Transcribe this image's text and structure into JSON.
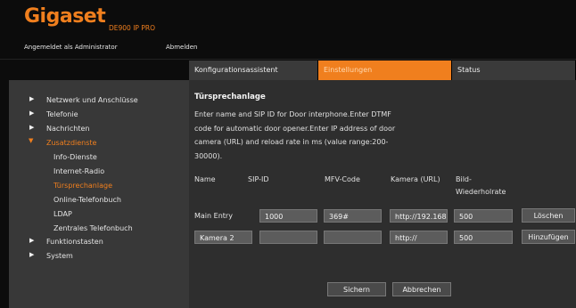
{
  "header": {
    "brand": "Gigaset",
    "model": "DE900 IP PRO",
    "logged_in_as": "Angemeldet als Administrator",
    "logout": "Abmelden"
  },
  "tabs": [
    {
      "label": "Konfigurationsassistent",
      "active": false
    },
    {
      "label": "Einstellungen",
      "active": true
    },
    {
      "label": "Status",
      "active": false
    }
  ],
  "sidebar": {
    "items": [
      {
        "label": "Netzwerk und Anschlüsse",
        "level": 0,
        "expanded": false,
        "active": false
      },
      {
        "label": "Telefonie",
        "level": 0,
        "expanded": false,
        "active": false
      },
      {
        "label": "Nachrichten",
        "level": 0,
        "expanded": false,
        "active": false
      },
      {
        "label": "Zusatzdienste",
        "level": 0,
        "expanded": true,
        "active": true
      },
      {
        "label": "Info-Dienste",
        "level": 1,
        "active": false
      },
      {
        "label": "Internet-Radio",
        "level": 1,
        "active": false
      },
      {
        "label": "Türsprechanlage",
        "level": 1,
        "active": true
      },
      {
        "label": "Online-Telefonbuch",
        "level": 1,
        "active": false
      },
      {
        "label": "LDAP",
        "level": 1,
        "active": false
      },
      {
        "label": "Zentrales Telefonbuch",
        "level": 1,
        "active": false
      },
      {
        "label": "Funktionstasten",
        "level": 0,
        "expanded": false,
        "active": false
      },
      {
        "label": "System",
        "level": 0,
        "expanded": false,
        "active": false
      }
    ]
  },
  "main": {
    "title": "Türsprechanlage",
    "description": "Enter name and SIP ID for Door interphone.Enter DTMF code for automatic door opener.Enter IP address of door camera (URL) and reload rate in ms (value range:200-30000).",
    "columns": [
      "Name",
      "SIP-ID",
      "MFV-Code",
      "Kamera (URL)",
      "Bild-Wiederholrate"
    ],
    "entries": [
      {
        "name": "Main Entry",
        "sip_id": "1000",
        "mfv_code": "369#",
        "camera_url": "http://192.168.",
        "rate": "500",
        "action": "Löschen"
      }
    ],
    "new_entry": {
      "name": "Kamera 2",
      "sip_id": "",
      "mfv_code": "",
      "camera_url": "http://",
      "rate": "500",
      "action": "Hinzufügen"
    },
    "save_label": "Sichern",
    "cancel_label": "Abbrechen"
  },
  "colors": {
    "accent": "#f07f1e",
    "panel": "#383838",
    "content": "#2e2e2e",
    "field": "#5c5c5c"
  }
}
